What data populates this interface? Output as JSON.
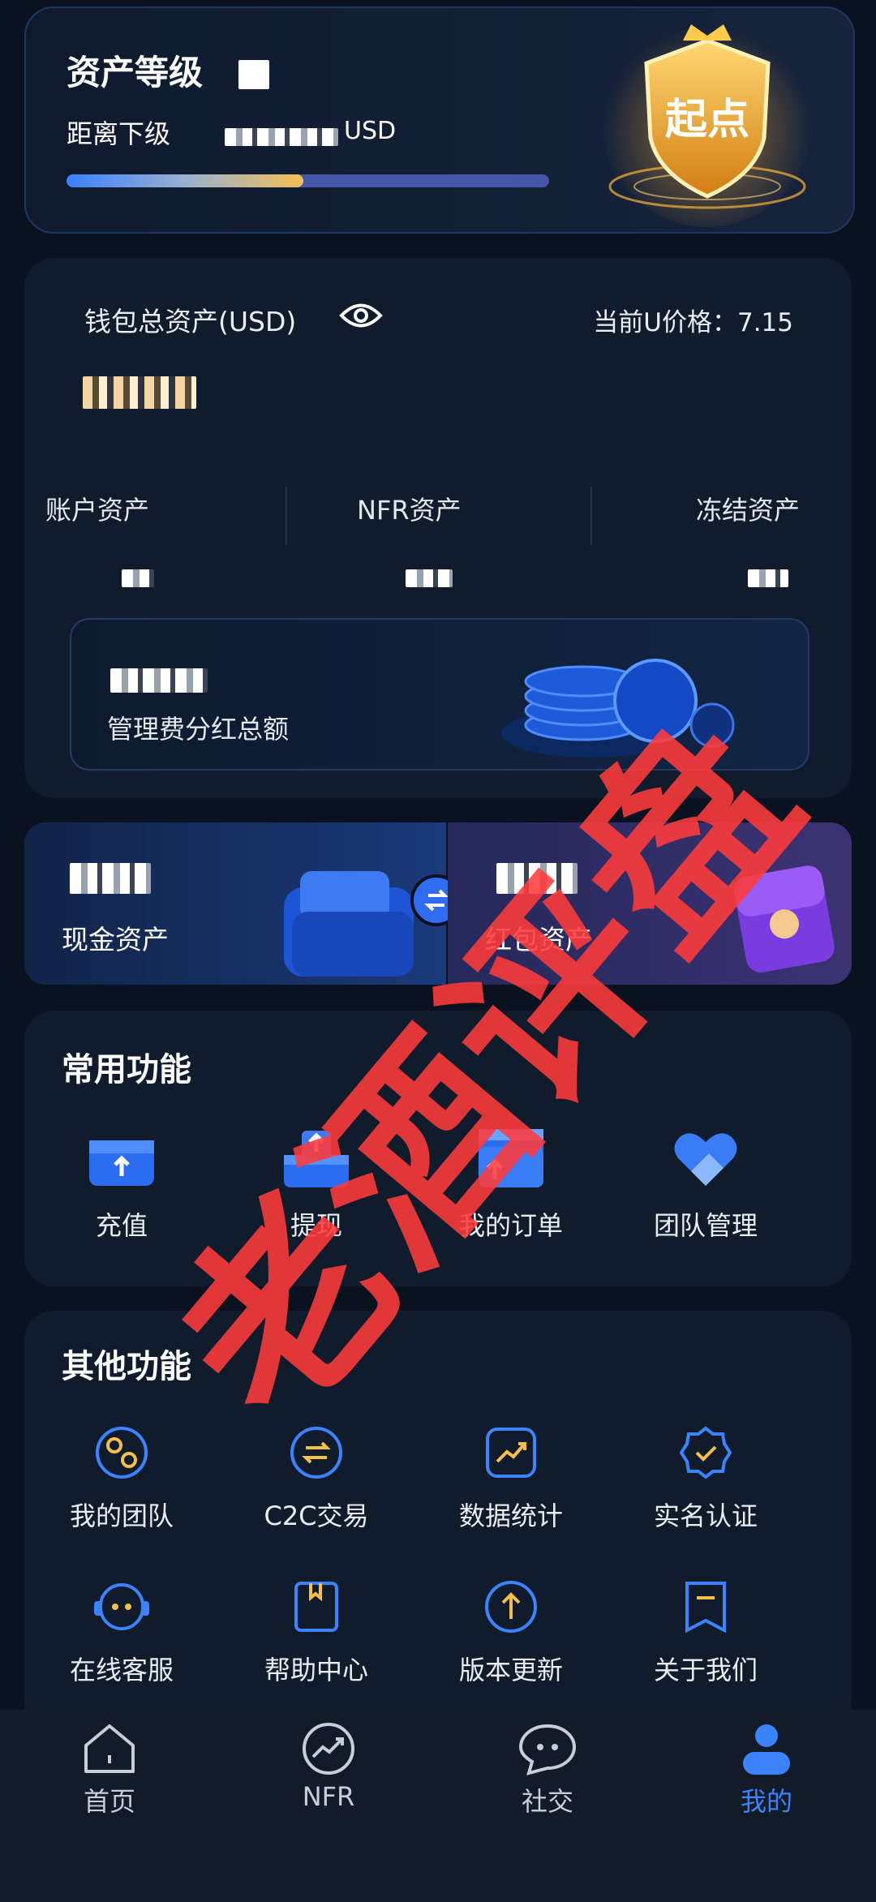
{
  "level_card": {
    "title": "资产等级",
    "subtitle": "距离下级",
    "unit_suffix": "USD",
    "progress": 0.49,
    "badge_text": "起点"
  },
  "wallet": {
    "title": "钱包总资产(USD)",
    "u_price_label": "当前U价格：7.15",
    "cols": [
      {
        "label": "账户资产"
      },
      {
        "label": "NFR资产"
      },
      {
        "label": "冻结资产"
      }
    ],
    "dividend_label": "管理费分红总额"
  },
  "cash": {
    "label": "现金资产"
  },
  "redpack": {
    "label": "红包资产"
  },
  "common": {
    "title": "常用功能",
    "items": [
      {
        "label": "充值",
        "icon": "deposit-icon"
      },
      {
        "label": "提现",
        "icon": "withdraw-icon"
      },
      {
        "label": "我的订单",
        "icon": "order-icon"
      },
      {
        "label": "团队管理",
        "icon": "team-manage-icon"
      }
    ]
  },
  "other": {
    "title": "其他功能",
    "items": [
      {
        "label": "我的团队",
        "icon": "team-icon"
      },
      {
        "label": "C2C交易",
        "icon": "exchange-icon"
      },
      {
        "label": "数据统计",
        "icon": "chart-icon"
      },
      {
        "label": "实名认证",
        "icon": "verify-icon"
      },
      {
        "label": "在线客服",
        "icon": "support-icon"
      },
      {
        "label": "帮助中心",
        "icon": "help-book-icon"
      },
      {
        "label": "版本更新",
        "icon": "update-icon"
      },
      {
        "label": "关于我们",
        "icon": "bookmark-icon"
      }
    ]
  },
  "watermark": "老酒评盘",
  "nav": [
    {
      "label": "首页",
      "icon": "home-icon"
    },
    {
      "label": "NFR",
      "icon": "trend-icon"
    },
    {
      "label": "社交",
      "icon": "chat-icon"
    },
    {
      "label": "我的",
      "icon": "profile-icon",
      "active": true
    }
  ],
  "colors": {
    "accent": "#3b83ff",
    "gold": "#f5c04a",
    "bg": "#0a1220",
    "watermark": "#ff3b3b"
  }
}
